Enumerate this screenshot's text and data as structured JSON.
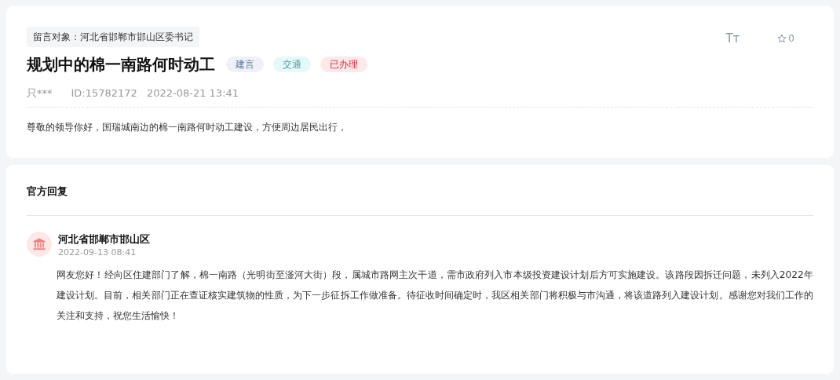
{
  "message": {
    "target": "留言对象：河北省邯郸市邯山区委书记",
    "title": "规划中的棉一南路何时动工",
    "tags": [
      {
        "label": "建言",
        "color": "#eef2f8"
      },
      {
        "label": "交通",
        "color": "#e6f9f9"
      },
      {
        "label": "已办理",
        "color": "#fde8ea"
      }
    ],
    "font_toggle": "Tт",
    "favorites": "0",
    "author": "只***",
    "id": "ID:15782172",
    "time": "2022-08-21 13:41",
    "body": "尊敬的领导你好，国瑞城南边的棉一南路何时动工建设，方便周边居民出行，"
  },
  "reply": {
    "heading": "官方回复",
    "department": "河北省邯郸市邯山区",
    "time": "2022-09-13 08:41",
    "body": "网友您好！经向区住建部门了解，棉一南路（光明街至滏河大街）段，属城市路网主次干道，需市政府列入市本级投资建设计划后方可实施建设。该路段因拆迁问题，未列入2022年建设计划。目前，相关部门正在查证核实建筑物的性质，为下一步征拆工作做准备。待征收时间确定时，我区相关部门将积极与市沟通，将该道路列入建设计划。感谢您对我们工作的关注和支持，祝您生活愉快！"
  }
}
